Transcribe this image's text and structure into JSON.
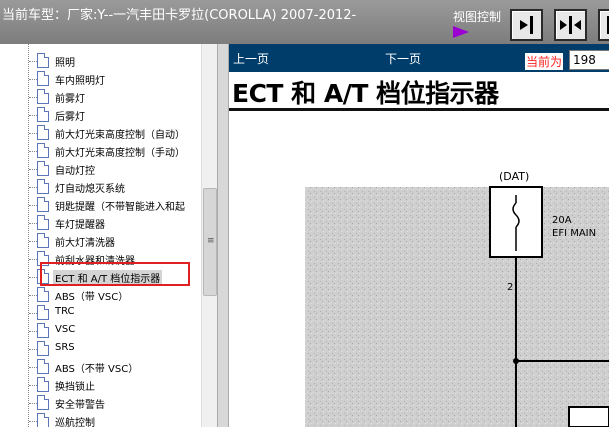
{
  "header": {
    "title": "当前车型：厂家:Y--一汽丰田卡罗拉(COROLLA) 2007-2012-",
    "view_control_label": "视图控制"
  },
  "toolbar_icons": [
    "panel-right-icon",
    "panel-split-icon",
    "panel-left-icon"
  ],
  "sidebar": {
    "items": [
      {
        "label": "照明"
      },
      {
        "label": "车内照明灯"
      },
      {
        "label": "前雾灯"
      },
      {
        "label": "后雾灯"
      },
      {
        "label": "前大灯光束高度控制（自动）"
      },
      {
        "label": "前大灯光束高度控制（手动）"
      },
      {
        "label": "自动灯控"
      },
      {
        "label": "灯自动熄灭系统"
      },
      {
        "label": "钥匙提醒（不带智能进入和起"
      },
      {
        "label": "车灯提醒器"
      },
      {
        "label": "前大灯清洗器"
      },
      {
        "label": "前刮水器和清洗器"
      },
      {
        "label": "ECT 和 A/T 档位指示器"
      },
      {
        "label": "ABS（带 VSC）"
      },
      {
        "label": "TRC"
      },
      {
        "label": "VSC"
      },
      {
        "label": "SRS"
      },
      {
        "label": "ABS（不带 VSC）"
      },
      {
        "label": "换挡锁止"
      },
      {
        "label": "安全带警告"
      },
      {
        "label": "巡航控制"
      }
    ],
    "selected_index": 12
  },
  "content": {
    "nav": {
      "prev_label": "上一页",
      "next_label": "下一页"
    },
    "page_label": "当前为",
    "page_value": "198",
    "doc_title": "ECT 和 A/T 档位指示器",
    "diagram": {
      "connector_label": "(DAT)",
      "fuse_rating": "20A",
      "fuse_name": "EFI MAIN",
      "pin_number": "2"
    }
  },
  "colors": {
    "header_bg": "#8a8a8a",
    "navbar_bg": "#003d6b",
    "highlight": "#e02020",
    "page_label": "#ff2222"
  }
}
